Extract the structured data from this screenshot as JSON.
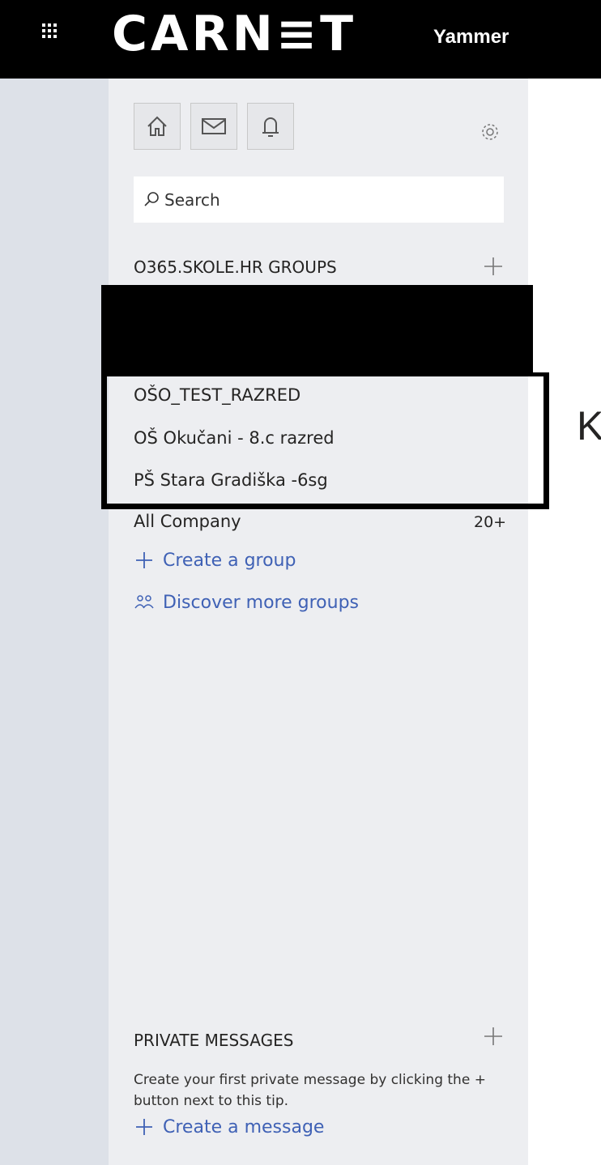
{
  "topbar": {
    "logo": "CARN≡T",
    "app_name": "Yammer"
  },
  "nav": {
    "icons": [
      "home-icon",
      "mail-icon",
      "bell-icon",
      "gear-icon"
    ],
    "search_placeholder": "Search",
    "groups_header": "O365.SKOLE.HR GROUPS",
    "groups": [
      {
        "label": "OŠO_TEST_RAZRED"
      },
      {
        "label": "OŠ Okučani - 8.c razred"
      },
      {
        "label": "PŠ Stara Gradiška -6sg"
      },
      {
        "label": "All Company",
        "count": "20+"
      }
    ],
    "create_group": "Create a group",
    "discover_groups": "Discover more groups",
    "pm_header": "PRIVATE MESSAGES",
    "pm_tip": "Create your first private message by clicking the + button next to this tip.",
    "create_message": "Create a message"
  },
  "main": {
    "partial_heading": "K"
  },
  "colors": {
    "topbar": "#000000",
    "nav_bg": "#edeef1",
    "rail_bg": "#dde1e8",
    "link": "#3f61b5"
  }
}
